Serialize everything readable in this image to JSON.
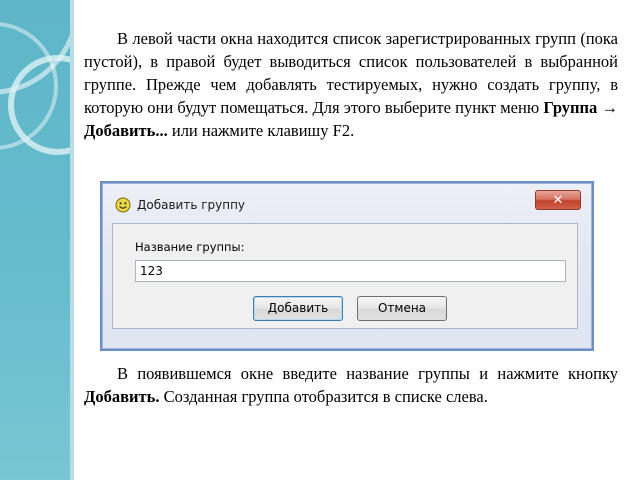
{
  "paragraph1": {
    "text_before": "В левой части окна находится список зарегистрированных групп (пока пустой), в правой будет выводиться список пользователей в выбранной группе. Прежде чем добавлять тестируемых, нужно создать группу, в которую они будут помещаться. Для этого выберите пункт меню ",
    "menu_item": "Группа",
    "arrow": " → ",
    "submenu_item": "Добавить...",
    "text_after": " или нажмите клавишу F2."
  },
  "dialog": {
    "title": "Добавить группу",
    "close_glyph": "✕",
    "field_label": "Название группы:",
    "field_value": "123",
    "ok_label": "Добавить",
    "cancel_label": "Отмена"
  },
  "paragraph2": {
    "text_before": "В появившемся окне введите название группы и нажмите кнопку ",
    "button_name": "Добавить.",
    "text_after": " Созданная группа отобразится в списке слева."
  },
  "colors": {
    "band": "#66bccd",
    "frame_border": "#6d8fc9",
    "close_button": "#c2432c"
  },
  "icons": {
    "app_icon": "smiley-icon"
  }
}
